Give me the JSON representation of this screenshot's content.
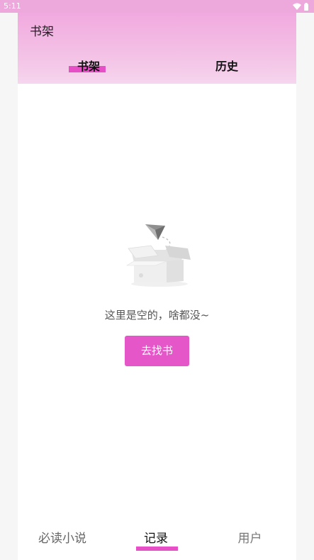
{
  "status_bar": {
    "time": "5:11",
    "icons": [
      "wifi-icon",
      "battery-icon"
    ]
  },
  "header": {
    "title": "书架",
    "tabs": [
      {
        "label": "书架",
        "selected": true
      },
      {
        "label": "历史",
        "selected": false
      }
    ]
  },
  "empty_state": {
    "illustration": "empty-box-icon",
    "message": "这里是空的，啥都没~",
    "button_label": "去找书"
  },
  "bottom_nav": {
    "items": [
      {
        "label": "必读小说",
        "selected": false
      },
      {
        "label": "记录",
        "selected": true
      },
      {
        "label": "用户",
        "selected": false
      }
    ]
  },
  "colors": {
    "accent": "#e64fc6",
    "button": "#e557c8",
    "header_top": "#f1a9df",
    "header_bottom": "#f6d6ee",
    "status_bar": "#eda8dc"
  }
}
